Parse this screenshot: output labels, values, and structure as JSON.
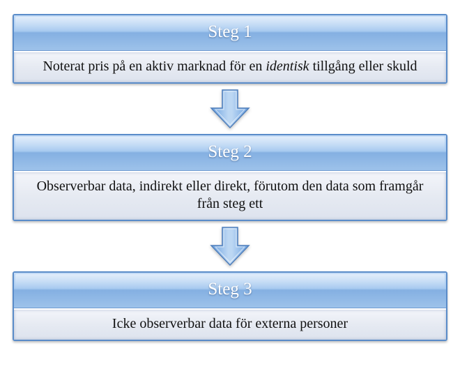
{
  "colors": {
    "blue_border": "#5a8cc9",
    "blue_light": "#a9cbf0",
    "blue_dark": "#6f9ad0",
    "body_bg": "#e9edf4",
    "text": "#111111",
    "header_text": "#ffffff"
  },
  "steps": [
    {
      "title": "Steg 1",
      "body_pre": "Noterat pris på en aktiv marknad för en ",
      "body_em": "identisk",
      "body_post": " tillgång eller skuld"
    },
    {
      "title": "Steg 2",
      "body_pre": "Observerbar data, indirekt eller direkt, förutom den data som framgår från steg ett",
      "body_em": "",
      "body_post": ""
    },
    {
      "title": "Steg 3",
      "body_pre": "Icke observerbar data för externa personer",
      "body_em": "",
      "body_post": ""
    }
  ]
}
